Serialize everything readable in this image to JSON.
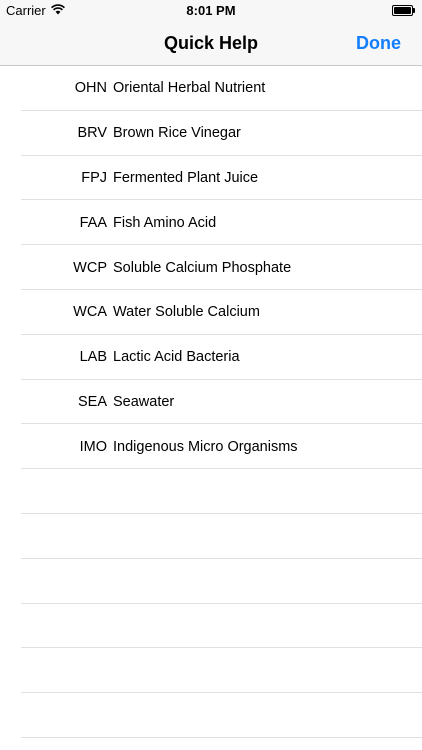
{
  "status_bar": {
    "carrier": "Carrier",
    "time": "8:01 PM",
    "icons": [
      "wifi-icon",
      "battery-icon"
    ]
  },
  "nav": {
    "title": "Quick Help",
    "done_label": "Done",
    "accent_color": "#147efb"
  },
  "items": [
    {
      "abbr": "OHN",
      "label": "Oriental Herbal Nutrient"
    },
    {
      "abbr": "BRV",
      "label": "Brown Rice Vinegar"
    },
    {
      "abbr": "FPJ",
      "label": "Fermented Plant Juice"
    },
    {
      "abbr": "FAA",
      "label": "Fish Amino Acid"
    },
    {
      "abbr": "WCP",
      "label": "Soluble Calcium Phosphate"
    },
    {
      "abbr": "WCA",
      "label": "Water Soluble Calcium"
    },
    {
      "abbr": "LAB",
      "label": "Lactic Acid Bacteria"
    },
    {
      "abbr": "SEA",
      "label": "Seawater"
    },
    {
      "abbr": "IMO",
      "label": "Indigenous Micro Organisms"
    }
  ]
}
